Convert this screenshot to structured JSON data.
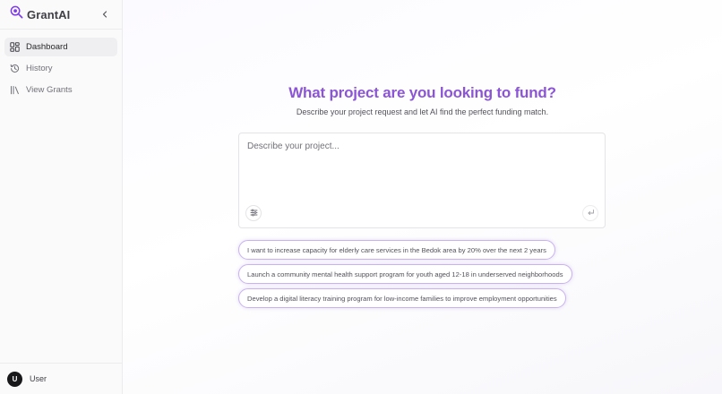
{
  "app": {
    "name": "GrantAI",
    "logo_icon": "magnifier-logo-icon",
    "accent": "#8b55d6"
  },
  "sidebar": {
    "collapse_icon": "chevron-left-icon",
    "items": [
      {
        "label": "Dashboard",
        "icon": "dashboard-icon",
        "active": true
      },
      {
        "label": "History",
        "icon": "history-icon",
        "active": false
      },
      {
        "label": "View Grants",
        "icon": "library-icon",
        "active": false
      }
    ],
    "user": {
      "initial": "U",
      "name": "User"
    }
  },
  "main": {
    "title": "What project are you looking to fund?",
    "subtitle": "Describe your project request and let AI find the perfect funding match.",
    "prompt": {
      "placeholder": "Describe your project...",
      "value": "",
      "tool_icon": "sliders-icon",
      "submit_icon": "enter-icon"
    },
    "suggestions": [
      "I want to increase capacity for elderly care services in the Bedok area by 20% over the next 2 years",
      "Launch a community mental health support program for youth aged 12-18 in underserved neighborhoods",
      "Develop a digital literacy training program for low-income families to improve employment opportunities"
    ]
  }
}
